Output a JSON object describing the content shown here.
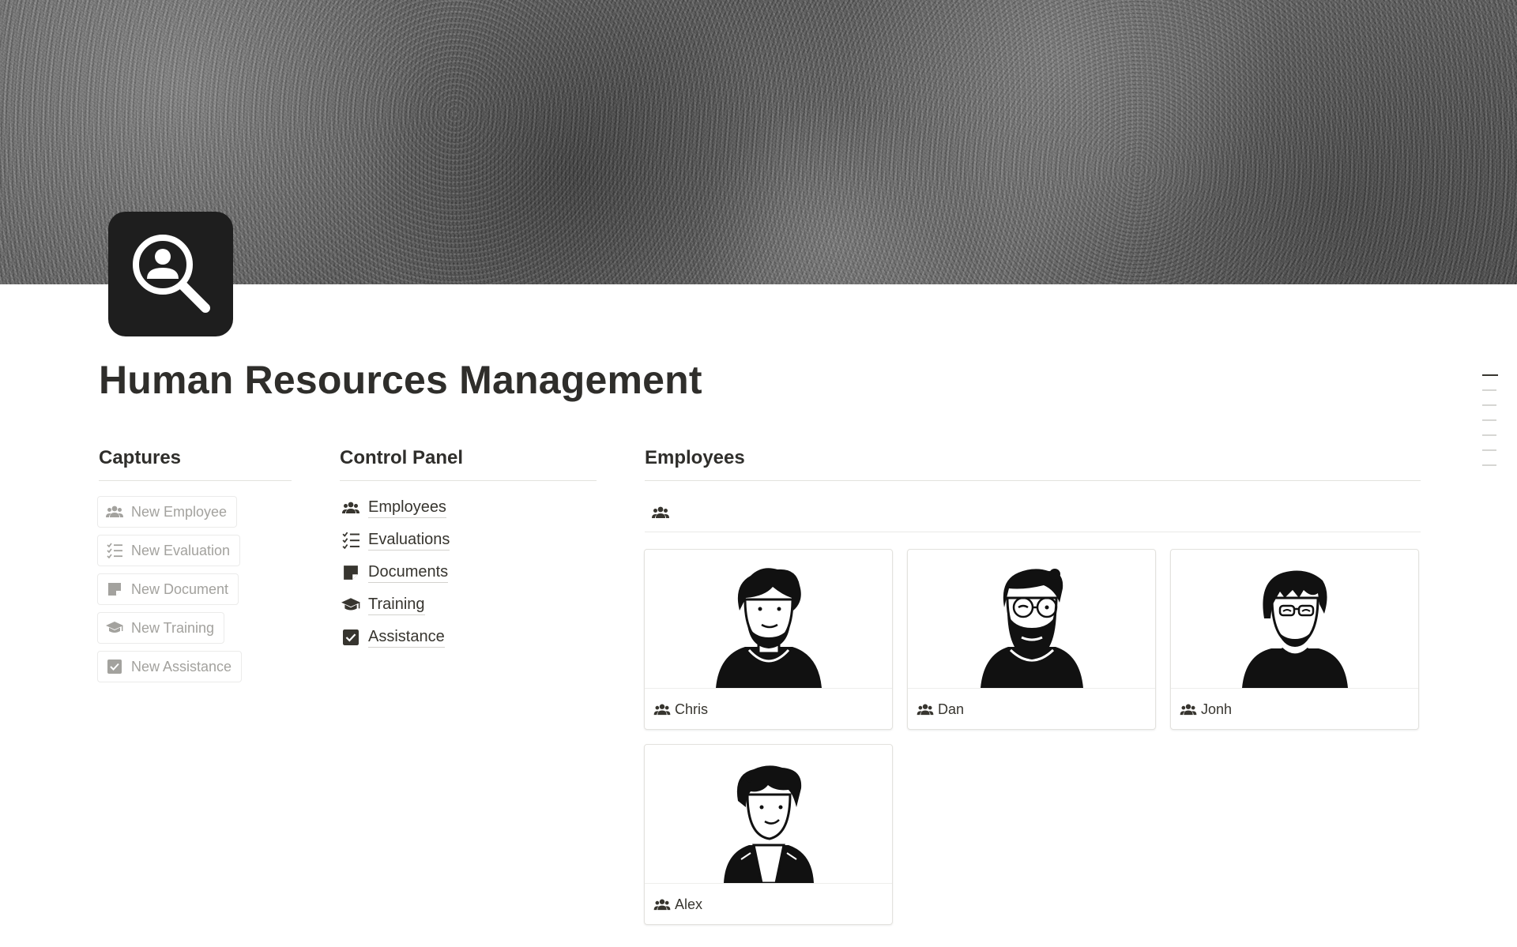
{
  "page": {
    "title": "Human Resources Management",
    "icon": "person-search-icon"
  },
  "captures": {
    "heading": "Captures",
    "buttons": [
      {
        "label": "New Employee",
        "icon": "people-icon"
      },
      {
        "label": "New Evaluation",
        "icon": "checklist-icon"
      },
      {
        "label": "New Document",
        "icon": "note-icon"
      },
      {
        "label": "New Training",
        "icon": "graduation-cap-icon"
      },
      {
        "label": "New Assistance",
        "icon": "checkbox-icon"
      }
    ]
  },
  "control_panel": {
    "heading": "Control Panel",
    "links": [
      {
        "label": "Employees",
        "icon": "people-icon"
      },
      {
        "label": "Evaluations",
        "icon": "checklist-icon"
      },
      {
        "label": "Documents",
        "icon": "note-icon"
      },
      {
        "label": "Training",
        "icon": "graduation-cap-icon"
      },
      {
        "label": "Assistance",
        "icon": "checkbox-icon"
      }
    ]
  },
  "employees": {
    "heading": "Employees",
    "view_icon": "people-icon",
    "cards": [
      {
        "name": "Chris",
        "icon": "people-icon",
        "avatar": "avatar-curly-beard"
      },
      {
        "name": "Dan",
        "icon": "people-icon",
        "avatar": "avatar-glasses-beard"
      },
      {
        "name": "Jonh",
        "icon": "people-icon",
        "avatar": "avatar-glasses-fringe"
      },
      {
        "name": "Alex",
        "icon": "people-icon",
        "avatar": "avatar-quiff-jacket"
      }
    ]
  },
  "toc": {
    "items": 7
  },
  "colors": {
    "text": "#37352f",
    "muted": "#a3a29e",
    "icon_bg": "#1e1e1e",
    "border": "#e3e2de"
  }
}
